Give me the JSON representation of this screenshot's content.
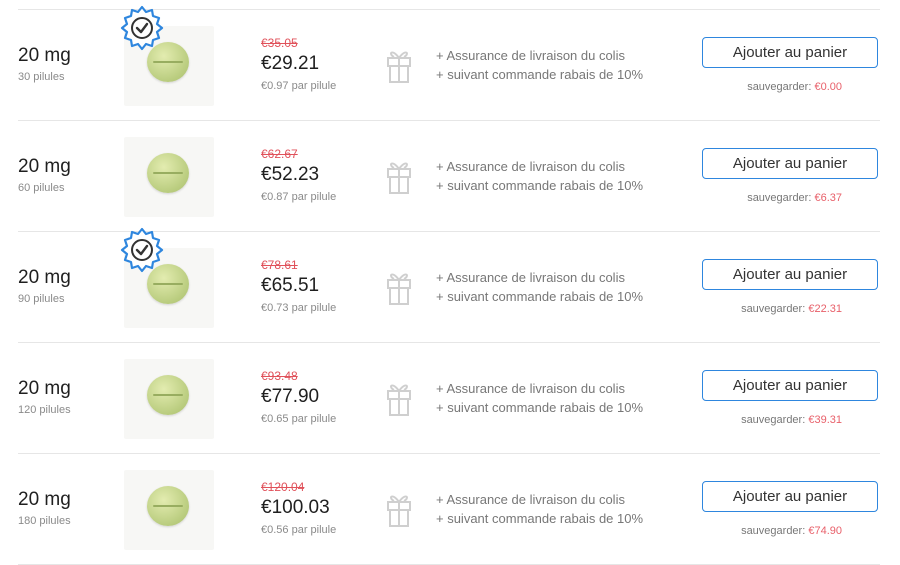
{
  "perks": [
    "+ Assurance de livraison du colis",
    "+ suivant commande rabais de 10%"
  ],
  "cart_label": "Ajouter au panier",
  "save_label": "sauvegarder:",
  "colors": {
    "accent": "#2e86de",
    "old_price": "#e0515a",
    "save_amount": "#e8606a"
  },
  "rows": [
    {
      "dose": "20 mg",
      "qty": "30 pilules",
      "old_price": "€35.05",
      "price": "€29.21",
      "per_pill": "€0.97 par pilule",
      "save": "€0.00",
      "badge": true
    },
    {
      "dose": "20 mg",
      "qty": "60 pilules",
      "old_price": "€62.67",
      "price": "€52.23",
      "per_pill": "€0.87 par pilule",
      "save": "€6.37",
      "badge": false
    },
    {
      "dose": "20 mg",
      "qty": "90 pilules",
      "old_price": "€78.61",
      "price": "€65.51",
      "per_pill": "€0.73 par pilule",
      "save": "€22.31",
      "badge": true
    },
    {
      "dose": "20 mg",
      "qty": "120 pilules",
      "old_price": "€93.48",
      "price": "€77.90",
      "per_pill": "€0.65 par pilule",
      "save": "€39.31",
      "badge": false
    },
    {
      "dose": "20 mg",
      "qty": "180 pilules",
      "old_price": "€120.04",
      "price": "€100.03",
      "per_pill": "€0.56 par pilule",
      "save": "€74.90",
      "badge": false
    }
  ]
}
